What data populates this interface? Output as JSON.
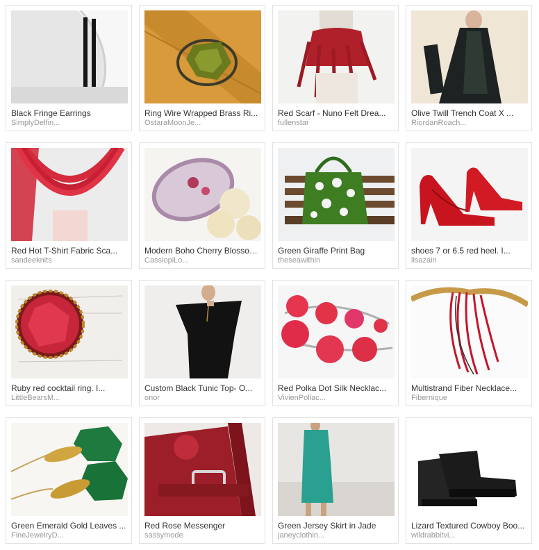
{
  "items": [
    {
      "title": "Black Fringe Earrings",
      "shop": "SimplyDelfin..."
    },
    {
      "title": "Ring Wire Wrapped Brass Ri...",
      "shop": "OstaraMoonJe..."
    },
    {
      "title": "Red Scarf - Nuno Felt Drea...",
      "shop": "fullenstar"
    },
    {
      "title": "Olive Twill Trench Coat X ...",
      "shop": "RiordanRoach..."
    },
    {
      "title": "Red Hot T-Shirt Fabric Sca...",
      "shop": "sandeeknits"
    },
    {
      "title": "Modern Boho Cherry Blossom...",
      "shop": "CassiopiLo..."
    },
    {
      "title": "Green Giraffe Print Bag",
      "shop": "theseawithin"
    },
    {
      "title": "shoes 7 or 6.5 red heel. I...",
      "shop": "lisazain"
    },
    {
      "title": "Ruby red cocktail ring. I...",
      "shop": "LittleBearsM..."
    },
    {
      "title": "Custom Black Tunic Top- O...",
      "shop": "onor"
    },
    {
      "title": "Red Polka Dot Silk Necklac...",
      "shop": "VivienPollac..."
    },
    {
      "title": "Multistrand Fiber Necklace...",
      "shop": "Fibernique"
    },
    {
      "title": "Green Emerald Gold Leaves ...",
      "shop": "FineJewelryD..."
    },
    {
      "title": "Red Rose Messenger",
      "shop": "sassymode"
    },
    {
      "title": "Green Jersey Skirt in Jade",
      "shop": "janeyclothin..."
    },
    {
      "title": "Lizard Textured Cowboy Boo...",
      "shop": "wildrabbitvi..."
    }
  ]
}
